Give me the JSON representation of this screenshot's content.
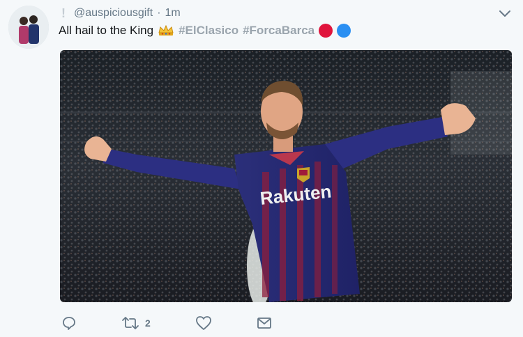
{
  "tweet": {
    "handle": "@auspiciousgift",
    "separator": "·",
    "time": "1m",
    "alert_glyph": "!",
    "text_prefix": "All hail to the King",
    "crown_emoji": "crown-emoji",
    "hashtags": [
      "#ElClasico",
      "#ForcaBarca"
    ],
    "circle_colors": [
      "#e0143c",
      "#2a8ff2"
    ],
    "retweet_count": "2",
    "icons": {
      "menu": "chevron-down-icon",
      "reply": "reply-icon",
      "retweet": "retweet-icon",
      "like": "heart-icon",
      "message": "envelope-icon"
    },
    "colors": {
      "hashtag": "#9aa4ad",
      "icon": "#657786",
      "background": "#f5f8fa"
    },
    "media": {
      "description": "photo",
      "shirt_sponsor": "Rakuten"
    }
  }
}
